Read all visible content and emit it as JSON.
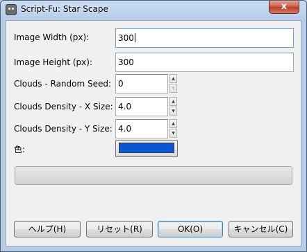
{
  "window": {
    "title": "Script-Fu: Star Scape",
    "close_glyph": "x"
  },
  "fields": {
    "width": {
      "label": "Image Width (px):",
      "value": "300"
    },
    "height": {
      "label": "Image Height (px):",
      "value": "300"
    },
    "seed": {
      "label": "Clouds - Random Seed:",
      "value": "0"
    },
    "xsize": {
      "label": "Clouds Density - X Size:",
      "value": "4.0"
    },
    "ysize": {
      "label": "Clouds Density - Y Size:",
      "value": "4.0"
    },
    "color": {
      "label": "色:",
      "value": "#0a55d4"
    }
  },
  "progress": {
    "fraction": 0
  },
  "buttons": {
    "help": "ヘルプ(H)",
    "reset": "リセット(R)",
    "ok": "OK(O)",
    "cancel": "キャンセル(C)"
  },
  "icons": {
    "spin_up": "▲",
    "spin_down": "▼"
  }
}
